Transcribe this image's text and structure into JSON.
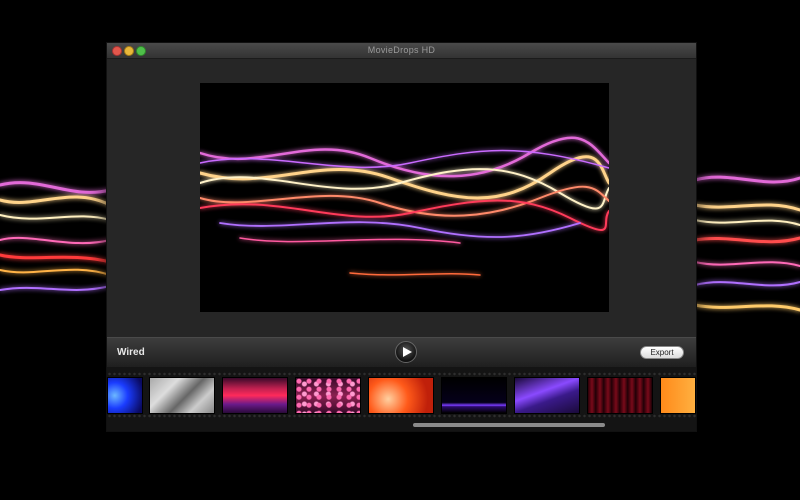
{
  "window": {
    "title": "MovieDrops HD"
  },
  "toolbar": {
    "preset_name": "Wired",
    "export_label": "Export"
  },
  "thumbnails": [
    {
      "name": "blue-burst"
    },
    {
      "name": "grey-crystal"
    },
    {
      "name": "red-purple-blocks"
    },
    {
      "name": "pink-particles"
    },
    {
      "name": "orange-petals"
    },
    {
      "name": "purple-line"
    },
    {
      "name": "purple-streaks"
    },
    {
      "name": "red-curtain"
    },
    {
      "name": "orange-glow"
    }
  ],
  "scroll": {
    "position": 0.52
  },
  "colors": {
    "accent_pink": "#ff5ad6",
    "accent_gold": "#ffd27a",
    "accent_red": "#ff4040",
    "accent_violet": "#b070ff"
  }
}
